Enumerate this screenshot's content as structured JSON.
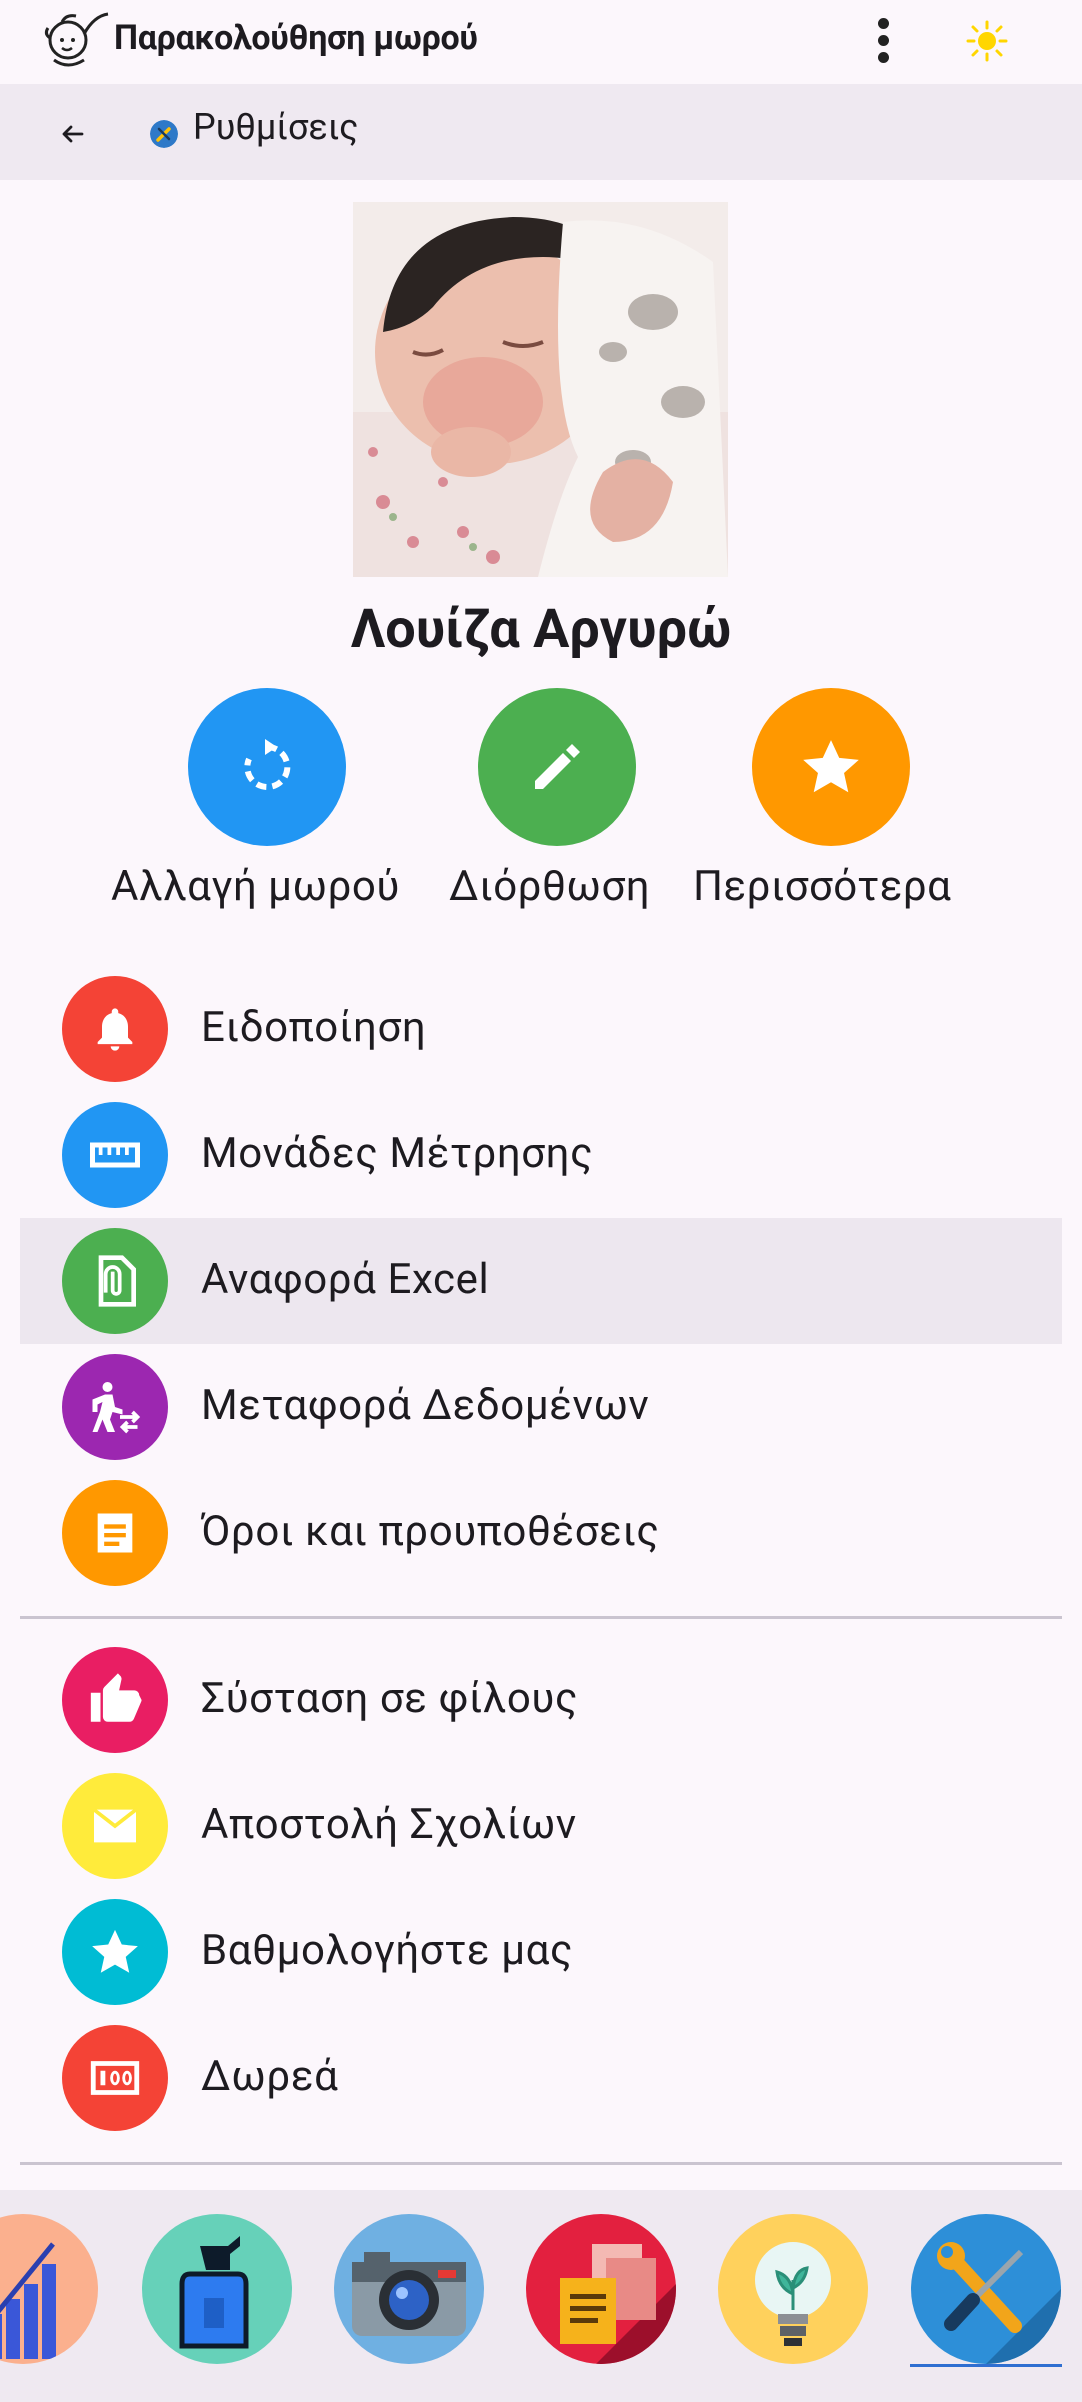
{
  "app": {
    "title": "Παρακολούθηση μωρού",
    "menu_icon": "more-vert-icon",
    "theme_icon": "sun-icon",
    "logo_icon": "baby-logo-icon"
  },
  "subheader": {
    "back_icon": "arrow-back-icon",
    "icon": "wrench-screwdriver-icon",
    "title": "Ρυθμίσεις"
  },
  "profile": {
    "name": "Λουίζα Αργυρώ",
    "photo_alt": "baby-photo"
  },
  "actions": [
    {
      "label": "Αλλαγή μωρού",
      "icon": "switch-baby-icon",
      "color": "#2196f3"
    },
    {
      "label": "Διόρθωση",
      "icon": "edit-pencil-icon",
      "color": "#4caf50"
    },
    {
      "label": "Περισσότερα",
      "icon": "star-icon",
      "color": "#ff9800"
    }
  ],
  "settings_group_1": [
    {
      "label": "Ειδοποίηση",
      "icon": "bell-icon",
      "color": "#f44336"
    },
    {
      "label": "Μονάδες Μέτρησης",
      "icon": "ruler-icon",
      "color": "#2196f3"
    },
    {
      "label": "Αναφορά Excel",
      "icon": "attachment-file-icon",
      "color": "#4caf50",
      "highlighted": true
    },
    {
      "label": "Μεταφορά Δεδομένων",
      "icon": "data-transfer-icon",
      "color": "#9c27b0"
    },
    {
      "label": "Όροι και προυποθέσεις",
      "icon": "document-icon",
      "color": "#ff9800"
    }
  ],
  "settings_group_2": [
    {
      "label": "Σύσταση σε φίλους",
      "icon": "thumbs-up-icon",
      "color": "#e91e63"
    },
    {
      "label": "Αποστολή Σχολίων",
      "icon": "envelope-icon",
      "color": "#ffeb3b"
    },
    {
      "label": "Βαθμολογήστε μας",
      "icon": "star-icon",
      "color": "#00bcd4"
    },
    {
      "label": "Δωρεά",
      "icon": "money-icon",
      "color": "#f44336"
    }
  ],
  "bottom_nav": [
    {
      "name": "nav-growth-chart",
      "icon": "bar-chart-icon",
      "color": "#fbb08e"
    },
    {
      "name": "nav-bottle",
      "icon": "spray-bottle-icon",
      "color": "#66d1b9"
    },
    {
      "name": "nav-camera",
      "icon": "camera-icon",
      "color": "#6fb0e2"
    },
    {
      "name": "nav-documents",
      "icon": "documents-icon",
      "color": "#e3203f"
    },
    {
      "name": "nav-tips",
      "icon": "lightbulb-icon",
      "color": "#ffd15c"
    },
    {
      "name": "nav-settings",
      "icon": "tools-icon",
      "color": "#2d8fd8",
      "selected": true
    }
  ]
}
